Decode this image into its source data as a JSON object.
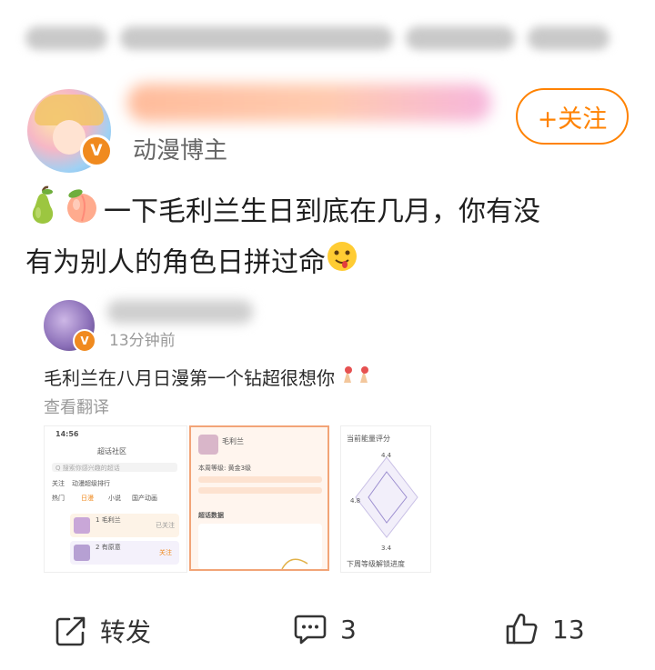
{
  "author": {
    "role": "动漫博主",
    "verified_badge": "V"
  },
  "follow_button": {
    "label": "+关注",
    "color": "#ff8200"
  },
  "post": {
    "emojis": [
      "pear-emoji",
      "peach-emoji",
      "drooling-face-emoji"
    ],
    "text_line1": "一下毛利兰生日到底在几月，你有没",
    "text_line2": "有为别人的角色日拼过命"
  },
  "quoted_post": {
    "time": "13分钟前",
    "verified_badge": "V",
    "text": "毛利兰在八月日漫第一个钻超很想你",
    "translate_label": "查看翻译",
    "screenshot_left": {
      "status_time": "14:56",
      "title": "超话社区",
      "search_placeholder": "Q 搜索你感兴趣的超话",
      "tabs": [
        "关注",
        "动漫超级排行",
        "热门",
        "小说",
        "国产动画",
        "日漫"
      ],
      "rows": [
        {
          "rank": "1",
          "name": "毛利兰",
          "action": "已关注"
        },
        {
          "rank": "2",
          "name": "有原意",
          "action": "关注"
        }
      ]
    },
    "screenshot_middle": {
      "name": "毛利兰",
      "level": "本周等级: 黄金3级",
      "section": "超话数据"
    },
    "screenshot_right": {
      "title": "当前能量评分",
      "values": [
        "4.4",
        "4.8",
        "3.4"
      ],
      "footer": "下周等级解锁进度"
    }
  },
  "actions": {
    "repost_label": "转发",
    "comment_count": "3",
    "like_count": "13"
  }
}
